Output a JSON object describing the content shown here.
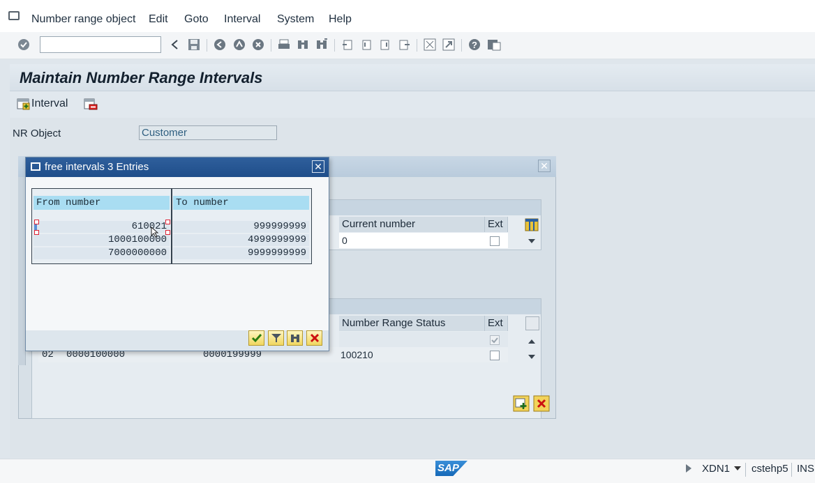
{
  "menu": {
    "items": [
      "Number range object",
      "Edit",
      "Goto",
      "Interval",
      "System",
      "Help"
    ]
  },
  "toolbar": {
    "command_field": "",
    "icons": [
      "enter-icon",
      "back-icon",
      "save-icon",
      "back-nav-icon",
      "exit-icon",
      "cancel-icon",
      "print-icon",
      "find-icon",
      "find-next-icon",
      "first-page-icon",
      "prev-page-icon",
      "next-page-icon",
      "last-page-icon",
      "new-session-icon",
      "shortcut-icon",
      "help-icon",
      "customize-layout-icon"
    ]
  },
  "page": {
    "title": "Maintain Number Range Intervals",
    "interval_button": "Interval",
    "nr_object_label": "NR Object",
    "nr_object_value": "Customer"
  },
  "background_dialog": {
    "top_table": {
      "columns": [
        "Current number",
        "Ext"
      ],
      "row_value": "0"
    },
    "bottom_table": {
      "columns": [
        "Number Range Status",
        "Ext"
      ],
      "row": {
        "no": "02",
        "from": "0000100000",
        "to": "0000199999",
        "status": "100210"
      }
    }
  },
  "popup": {
    "title": "free intervals 3 Entries",
    "columns": [
      "From number",
      "To number"
    ],
    "rows": [
      {
        "from": "610021",
        "to": "999999999"
      },
      {
        "from": "1000100000",
        "to": "4999999999"
      },
      {
        "from": "7000000000",
        "to": "9999999999"
      }
    ]
  },
  "statusbar": {
    "logo": "SAP",
    "system": "XDN1",
    "server": "cstehp5",
    "mode": "INS"
  }
}
